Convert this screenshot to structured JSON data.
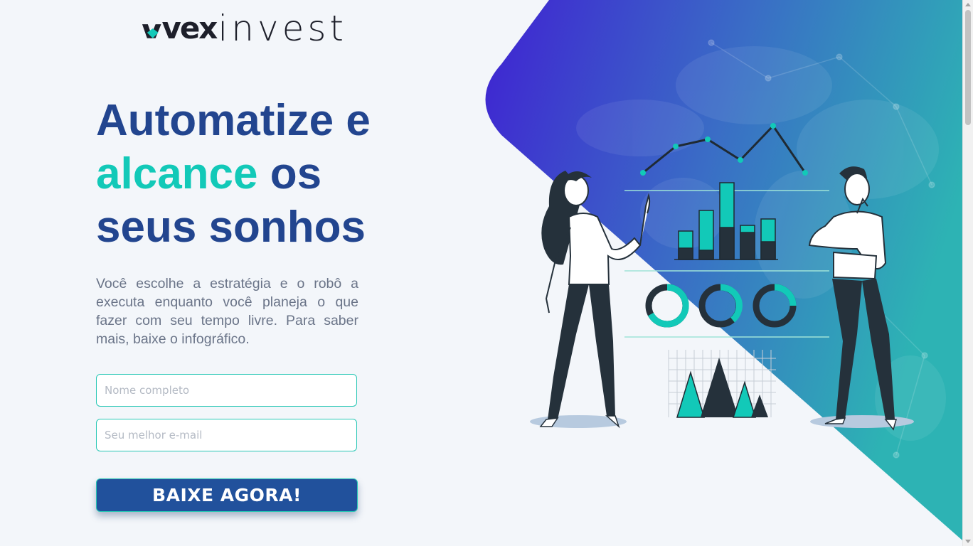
{
  "brand": {
    "logo_bold": "vex",
    "logo_light": "invest",
    "colors": {
      "primary": "#22458f",
      "accent": "#12c9b8",
      "button": "#21519c"
    }
  },
  "hero": {
    "headline_line1": "Automatize e",
    "headline_accent": "alcance",
    "headline_line2_rest": " os",
    "headline_line3": "seus sonhos",
    "description": "Você escolhe a estratégia e o robô a executa enquanto você planeja o que fazer com seu tempo livre. Para saber mais, baixe o infográfico.",
    "illustration": "analytics-illustration"
  },
  "form": {
    "name_placeholder": "Nome completo",
    "email_placeholder": "Seu melhor e-mail",
    "submit_label": "BAIXE AGORA!"
  }
}
